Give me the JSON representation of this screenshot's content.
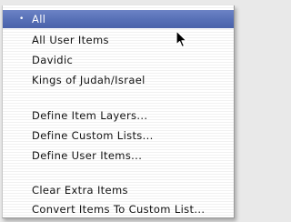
{
  "menu": {
    "items": [
      {
        "label": "All",
        "checked": true
      },
      {
        "label": "All User Items"
      },
      {
        "label": "Davidic"
      },
      {
        "label": "Kings of Judah/Israel"
      },
      {
        "label": "Define Item Layers..."
      },
      {
        "label": "Define Custom Lists..."
      },
      {
        "label": "Define User Items..."
      },
      {
        "label": "Clear Extra Items"
      },
      {
        "label": "Convert Items To Custom List..."
      }
    ],
    "check_glyph": "•"
  },
  "colors": {
    "selection": "#566fb6",
    "selection_text": "#ffffff",
    "menu_text": "#111111"
  },
  "icons": {
    "pointer": "arrow-cursor-icon"
  }
}
